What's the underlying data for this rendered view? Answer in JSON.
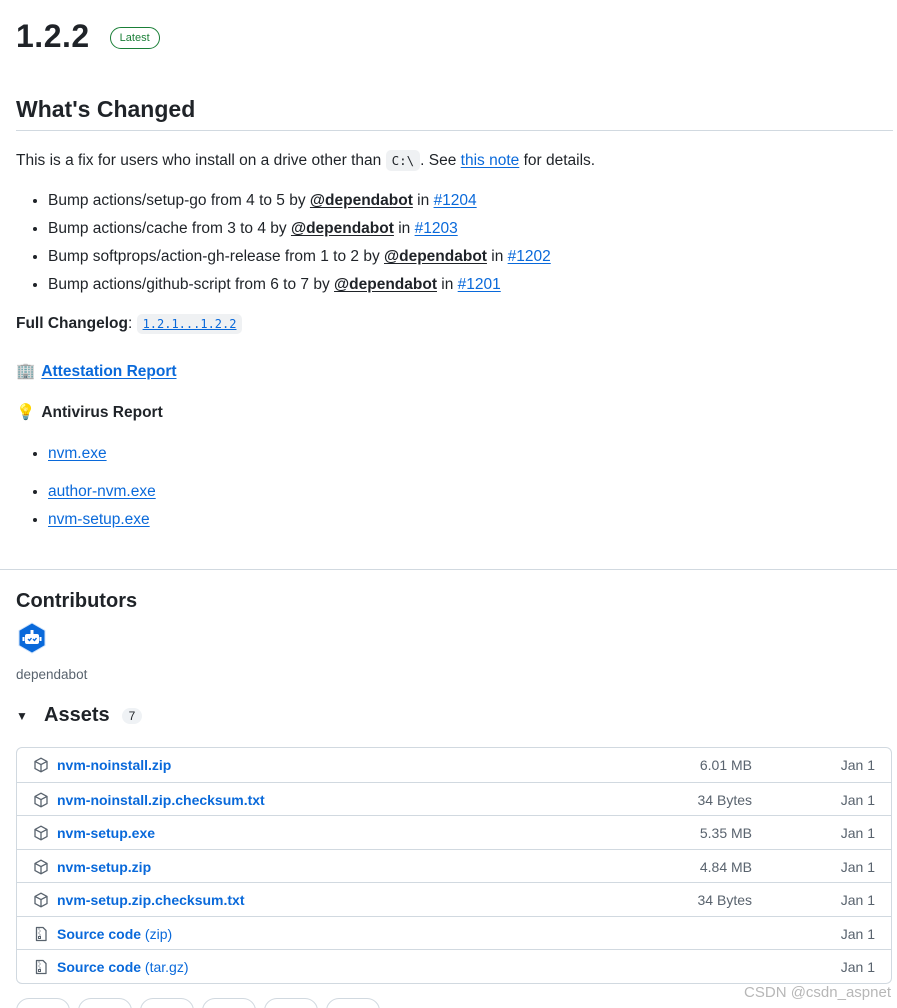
{
  "release": {
    "version": "1.2.2",
    "badge": "Latest"
  },
  "changes": {
    "heading": "What's Changed",
    "intro_before": "This is a fix for users who install on a drive other than ",
    "intro_code": "C:\\",
    "intro_middle": ". See ",
    "intro_link": "this note",
    "intro_after": " for details.",
    "items": [
      {
        "text": "Bump actions/setup-go from 4 to 5 by ",
        "author": "@dependabot",
        "in": " in ",
        "pr": "#1204"
      },
      {
        "text": "Bump actions/cache from 3 to 4 by ",
        "author": "@dependabot",
        "in": " in ",
        "pr": "#1203"
      },
      {
        "text": "Bump softprops/action-gh-release from 1 to 2 by ",
        "author": "@dependabot",
        "in": " in ",
        "pr": "#1202"
      },
      {
        "text": "Bump actions/github-script from 6 to 7 by ",
        "author": "@dependabot",
        "in": " in ",
        "pr": "#1201"
      }
    ],
    "changelog_label": "Full Changelog",
    "changelog_colon": ": ",
    "changelog_link": "1.2.1...1.2.2"
  },
  "reports": {
    "attestation_icon": "🏢",
    "attestation_label": "Attestation Report",
    "antivirus_icon": "💡",
    "antivirus_label": "Antivirus Report",
    "antivirus_links": [
      "nvm.exe",
      "author-nvm.exe",
      "nvm-setup.exe"
    ]
  },
  "contributors": {
    "title": "Contributors",
    "name": "dependabot"
  },
  "assets": {
    "title": "Assets",
    "count": "7",
    "caret": "▼",
    "rows": [
      {
        "icon": "package-icon",
        "name": "nvm-noinstall.zip",
        "sub": "",
        "size": "6.01 MB",
        "date": "Jan 1"
      },
      {
        "icon": "package-icon",
        "name": "nvm-noinstall.zip.checksum.txt",
        "sub": "",
        "size": "34 Bytes",
        "date": "Jan 1"
      },
      {
        "icon": "package-icon",
        "name": "nvm-setup.exe",
        "sub": "",
        "size": "5.35 MB",
        "date": "Jan 1"
      },
      {
        "icon": "package-icon",
        "name": "nvm-setup.zip",
        "sub": "",
        "size": "4.84 MB",
        "date": "Jan 1"
      },
      {
        "icon": "package-icon",
        "name": "nvm-setup.zip.checksum.txt",
        "sub": "",
        "size": "34 Bytes",
        "date": "Jan 1"
      },
      {
        "icon": "file-zip-icon",
        "name": "Source code",
        "sub": " (zip)",
        "size": "",
        "date": "Jan 1"
      },
      {
        "icon": "file-zip-icon",
        "name": "Source code",
        "sub": " (tar.gz)",
        "size": "",
        "date": "Jan 1"
      }
    ]
  },
  "watermark": "CSDN @csdn_aspnet",
  "colors": {
    "link": "#0969da",
    "badge_green": "#1a7f37",
    "text": "#1f2328",
    "muted": "#59636e",
    "border": "#d1d9e0",
    "avatar_blue": "#0969da"
  }
}
